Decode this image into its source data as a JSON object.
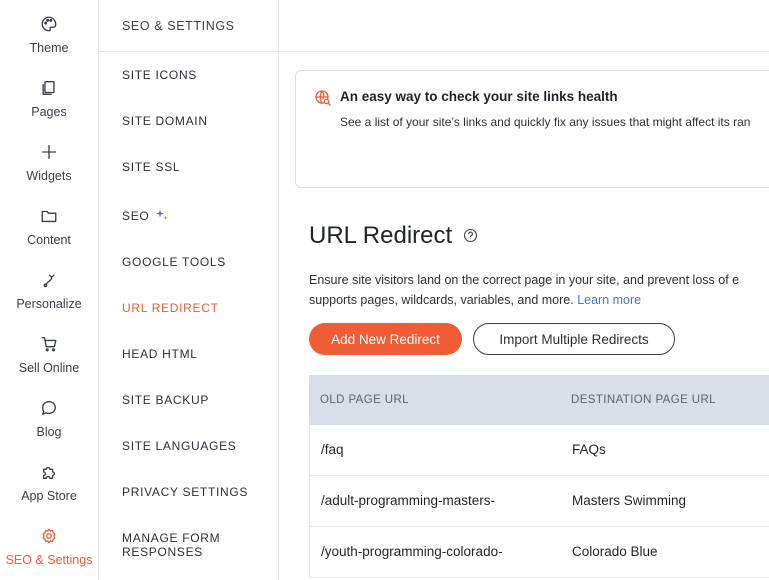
{
  "rail": {
    "items": [
      {
        "label": "Theme",
        "icon": "palette-icon"
      },
      {
        "label": "Pages",
        "icon": "pages-icon"
      },
      {
        "label": "Widgets",
        "icon": "plus-icon"
      },
      {
        "label": "Content",
        "icon": "folder-icon"
      },
      {
        "label": "Personalize",
        "icon": "personalize-icon"
      },
      {
        "label": "Sell Online",
        "icon": "cart-icon"
      },
      {
        "label": "Blog",
        "icon": "chat-bubble-icon"
      },
      {
        "label": "App Store",
        "icon": "puzzle-icon"
      },
      {
        "label": "SEO & Settings",
        "icon": "gear-icon",
        "active": true
      }
    ]
  },
  "subnav": {
    "title": "SEO & SETTINGS",
    "items": [
      {
        "label": "SITE ICONS"
      },
      {
        "label": "SITE DOMAIN"
      },
      {
        "label": "SITE SSL"
      },
      {
        "label": "SEO"
      },
      {
        "label": "GOOGLE TOOLS"
      },
      {
        "label": "URL REDIRECT",
        "active": true
      },
      {
        "label": "HEAD HTML"
      },
      {
        "label": "SITE BACKUP"
      },
      {
        "label": "SITE LANGUAGES"
      },
      {
        "label": "PRIVACY SETTINGS"
      },
      {
        "label": "MANAGE FORM",
        "label2": "RESPONSES"
      }
    ]
  },
  "banner": {
    "icon": "globe-search-icon",
    "title": "An easy way to check your site links health",
    "text": "See a list of your site’s links and quickly fix any issues that might affect its ran"
  },
  "main": {
    "title": "URL Redirect",
    "desc_line1": "Ensure site visitors land on the correct page in your site, and prevent loss of e",
    "desc_line2": "supports pages, wildcards, variables, and more.",
    "learn_more": "Learn more",
    "add_button": "Add New Redirect",
    "import_button": "Import Multiple Redirects"
  },
  "table": {
    "columns": [
      "OLD PAGE URL",
      "DESTINATION PAGE URL"
    ],
    "rows": [
      {
        "old": "/faq",
        "dest": "FAQs"
      },
      {
        "old": "/adult-programming-masters-",
        "dest": "Masters Swimming"
      },
      {
        "old": "/youth-programming-colorado-",
        "dest": "Colorado Blue"
      }
    ]
  },
  "colors": {
    "accent": "#ef5c35",
    "link": "#3b7bd4",
    "table_header": "#d9dfe6"
  }
}
